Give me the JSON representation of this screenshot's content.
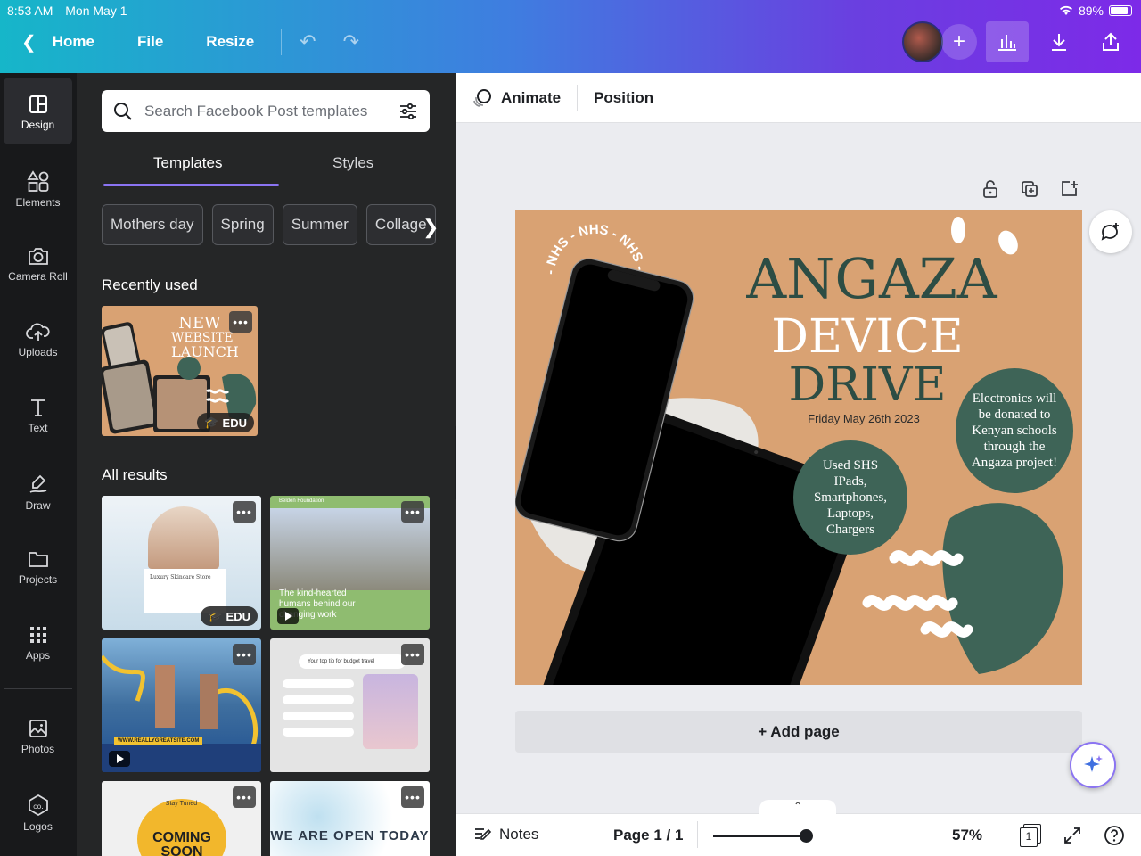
{
  "status": {
    "time": "8:53 AM",
    "date": "Mon May 1",
    "battery": "89%"
  },
  "nav": {
    "home": "Home",
    "file": "File",
    "resize": "Resize"
  },
  "rail": [
    {
      "label": "Design"
    },
    {
      "label": "Elements"
    },
    {
      "label": "Camera Roll"
    },
    {
      "label": "Uploads"
    },
    {
      "label": "Text"
    },
    {
      "label": "Draw"
    },
    {
      "label": "Projects"
    },
    {
      "label": "Apps"
    },
    {
      "label": "Photos"
    },
    {
      "label": "Logos"
    }
  ],
  "panel": {
    "search_placeholder": "Search Facebook Post templates",
    "tabs": [
      "Templates",
      "Styles"
    ],
    "chips": [
      "Mothers day",
      "Spring",
      "Summer",
      "Collage"
    ],
    "recently_used": "Recently used",
    "all_results": "All results",
    "recent_thumb": {
      "title_lines": [
        "NEW",
        "WEBSITE",
        "LAUNCH"
      ],
      "badge": "EDU"
    },
    "results": [
      {
        "title": "Luxury Skincare Store",
        "badge": "EDU"
      },
      {
        "org": "Belden Foundation",
        "text": "The kind-hearted humans behind our changing work"
      },
      {
        "url": "WWW.REALLYGREATSITE.COM"
      },
      {
        "search": "Your top tip for budget travel"
      },
      {
        "text1": "Stay Tuned",
        "text2": "COMING SOON"
      },
      {
        "text": "WE ARE OPEN TODAY"
      }
    ]
  },
  "context": {
    "animate": "Animate",
    "position": "Position"
  },
  "design": {
    "badge_text": "- NHS - NHS - NHS -",
    "title1": "ANGAZA",
    "title2": "DEVICE",
    "title3": "DRIVE",
    "date": "Friday May 26th 2023",
    "circle1": "Used SHS IPads, Smartphones, Laptops, Chargers",
    "circle2": "Electronics will be donated to Kenyan schools through the Angaza project!",
    "bg_color": "#d9a273",
    "accent": "#3e6457"
  },
  "add_page": "+ Add page",
  "bottom": {
    "notes": "Notes",
    "page": "Page 1 / 1",
    "zoom": "57%",
    "zoom_value": 0.57,
    "page_count": "1"
  }
}
